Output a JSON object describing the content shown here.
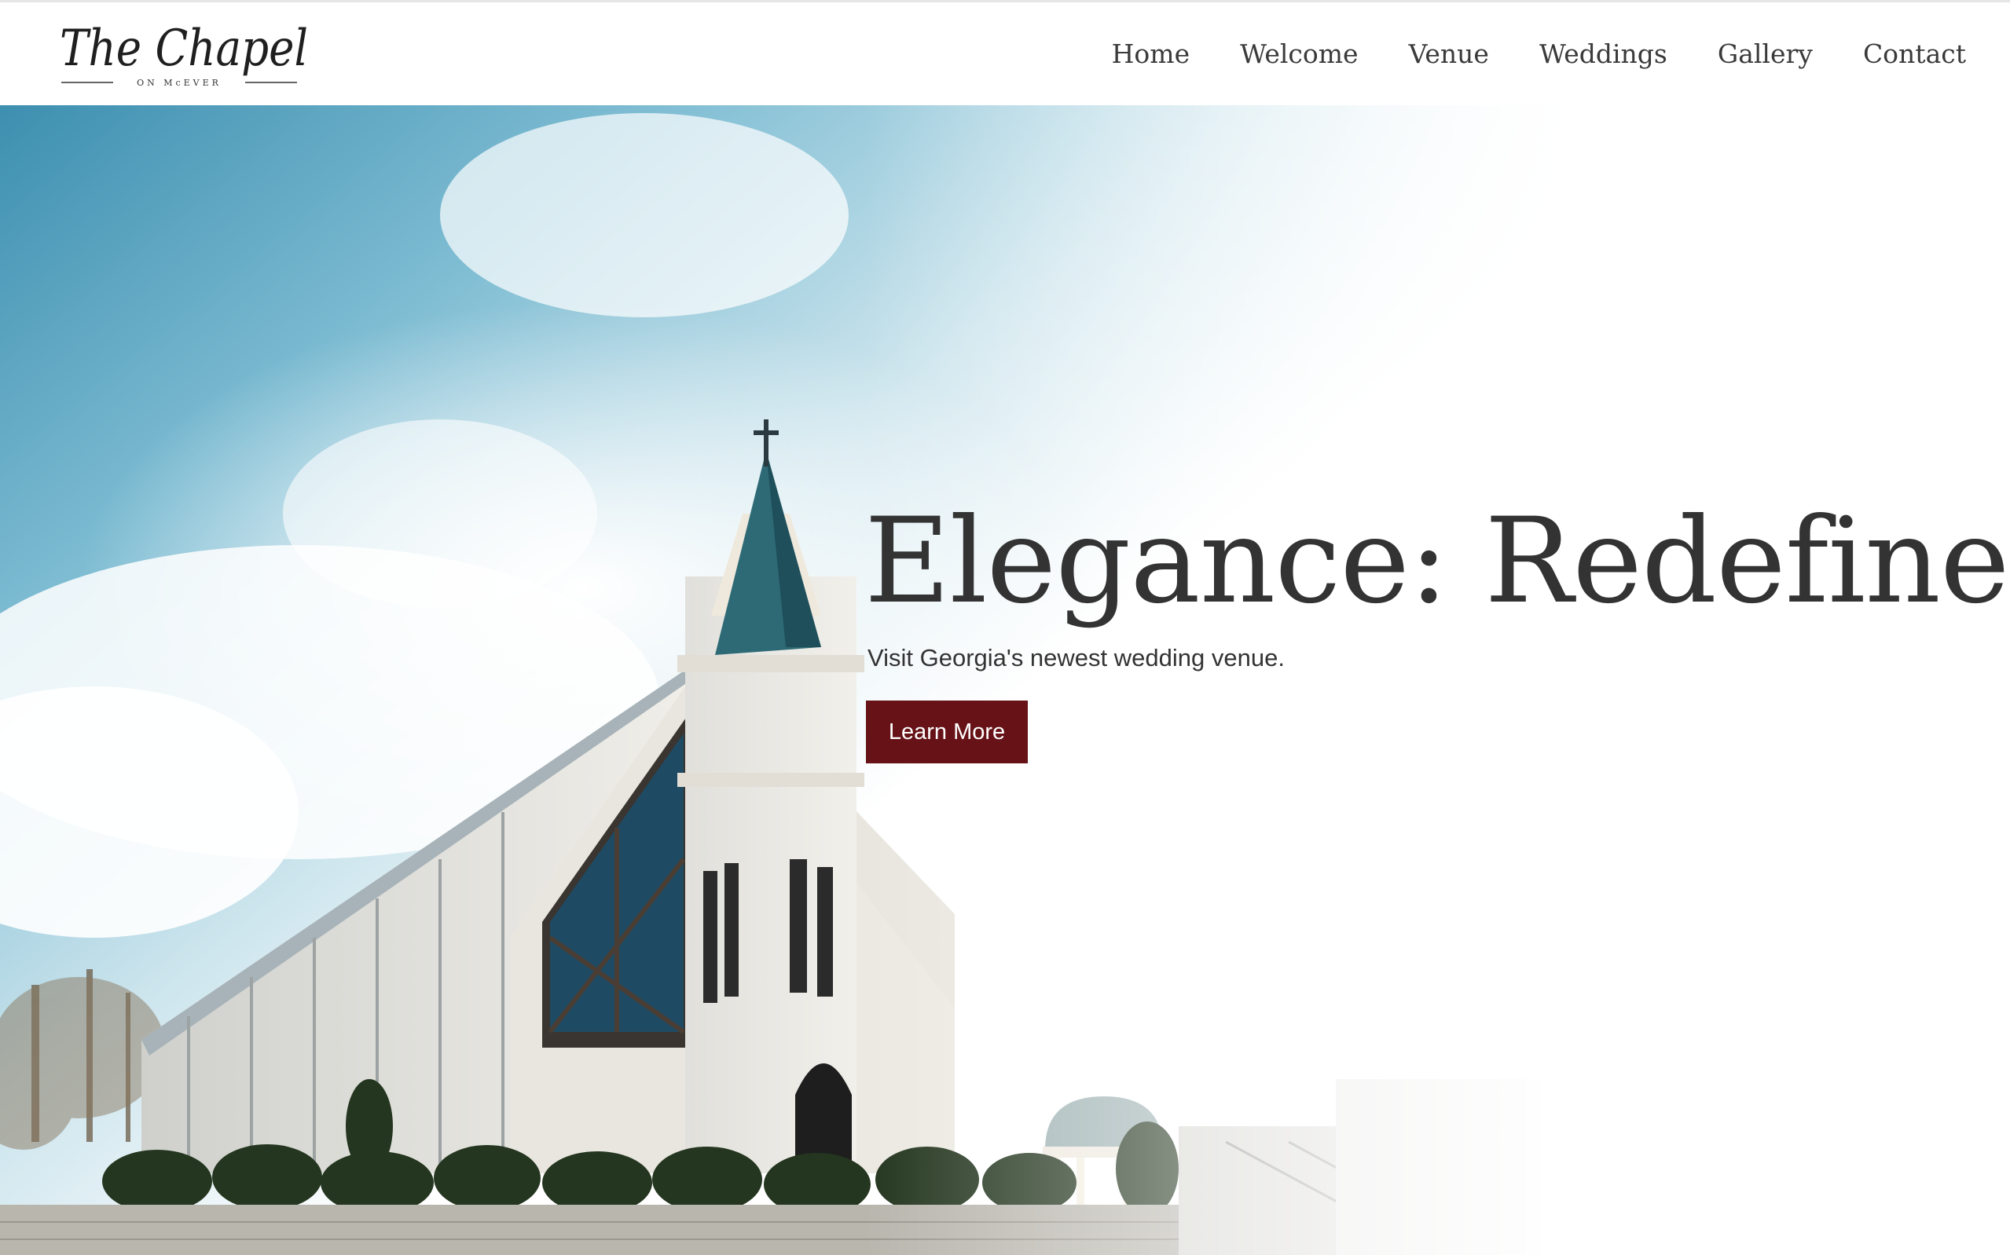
{
  "brand": {
    "logo_script": "The Chapel",
    "logo_tagline": "ON McEVER"
  },
  "nav": {
    "items": [
      {
        "label": "Home"
      },
      {
        "label": "Welcome"
      },
      {
        "label": "Venue"
      },
      {
        "label": "Weddings"
      },
      {
        "label": "Gallery"
      },
      {
        "label": "Contact"
      }
    ]
  },
  "hero": {
    "title": "Elegance: Redefined",
    "subtitle": "Visit Georgia's newest wedding venue.",
    "cta_label": "Learn More"
  },
  "colors": {
    "accent": "#661217",
    "text": "#333333",
    "sky": "#5ea6c2",
    "background": "#ffffff"
  }
}
